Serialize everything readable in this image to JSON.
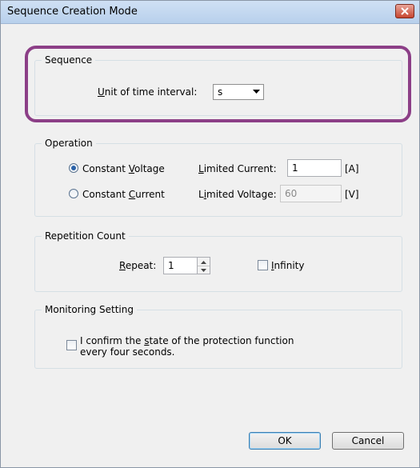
{
  "window": {
    "title": "Sequence Creation Mode"
  },
  "sequence": {
    "group_title": "Sequence",
    "unit_label_mnemonic": "U",
    "unit_label_rest": "nit of time interval:",
    "unit_value": "s"
  },
  "operation": {
    "group_title": "Operation",
    "cv_label_pre": "Constant ",
    "cv_label_mnemonic": "V",
    "cv_label_post": "oltage",
    "cc_label_pre": "Constant ",
    "cc_label_mnemonic": "C",
    "cc_label_post": "urrent",
    "selected": "Constant Voltage",
    "limited_current_mnemonic": "L",
    "limited_current_rest": "imited Current:",
    "limited_current_value": "1",
    "limited_current_unit": "[A]",
    "limited_voltage_pre": "L",
    "limited_voltage_mnemonic": "i",
    "limited_voltage_rest": "mited Voltage:",
    "limited_voltage_value": "60",
    "limited_voltage_unit": "[V]"
  },
  "repetition": {
    "group_title": "Repetition Count",
    "repeat_mnemonic": "R",
    "repeat_rest": "epeat:",
    "repeat_value": "1",
    "infinity_mnemonic": "I",
    "infinity_rest": "nfinity"
  },
  "monitoring": {
    "group_title": "Monitoring Setting",
    "line1_pre": "I confirm the ",
    "line1_mnemonic": "s",
    "line1_post": "tate of the protection function",
    "line2": "every four seconds."
  },
  "buttons": {
    "ok": "OK",
    "cancel": "Cancel"
  }
}
